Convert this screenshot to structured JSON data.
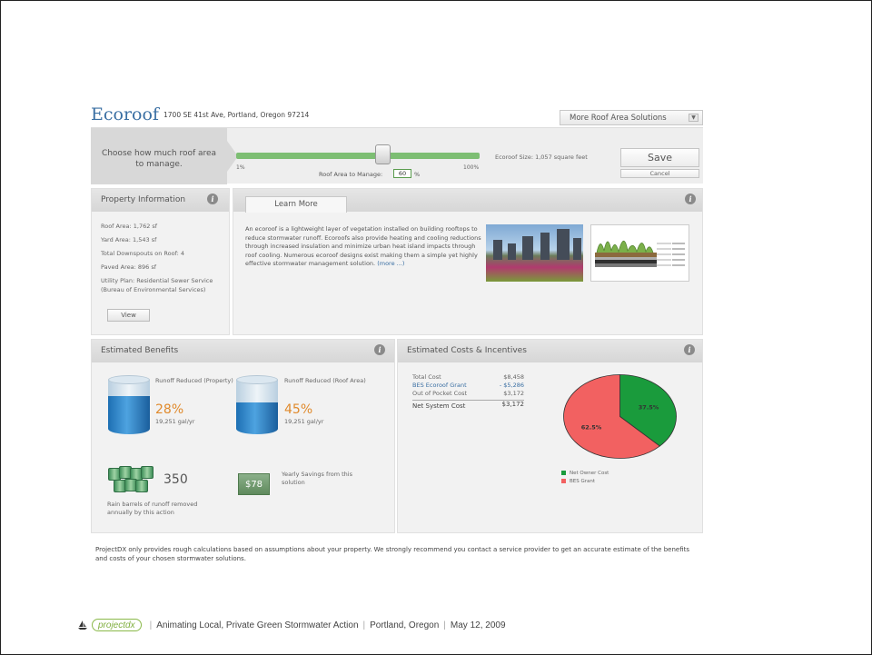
{
  "header": {
    "title": "Ecoroof",
    "address": "1700 SE 41st Ave, Portland, Oregon 97214",
    "more_solutions": "More Roof Area Solutions"
  },
  "control": {
    "choose_text": "Choose how much roof area to manage.",
    "slider_min": "1%",
    "slider_max": "100%",
    "slider_value_fraction": 0.6,
    "manage_label": "Roof Area to Manage:",
    "manage_value": "60",
    "manage_unit": "%",
    "ecoroof_size": "Ecoroof Size: 1,057 square feet",
    "save_label": "Save",
    "cancel_label": "Cancel"
  },
  "property": {
    "title": "Property Information",
    "items": [
      "Roof Area: 1,762 sf",
      "Yard Area: 1,543 sf",
      "Total Downspouts on Roof: 4",
      "Paved Area: 896 sf",
      "Utility Plan: Residential Sewer Service (Bureau of Environmental Services)"
    ],
    "view_label": "View"
  },
  "learn": {
    "tab_label": "Learn More",
    "text": "An ecoroof is a lightweight layer of vegetation installed on building rooftops to reduce stormwater runoff. Ecoroofs also provide heating and cooling reductions through increased insulation and minimize urban heat island impacts through roof cooling. Numerous ecoroof designs exist making them a simple yet highly effective stormwater management solution.",
    "more_link": "(more ...)"
  },
  "benefits": {
    "title": "Estimated Benefits",
    "property": {
      "label": "Runoff Reduced (Property)",
      "percent": "28%",
      "gallons": "19,251 gal/yr",
      "fill_fraction": 0.28
    },
    "roof": {
      "label": "Runoff Reduced (Roof Area)",
      "percent": "45%",
      "gallons": "19,251 gal/yr",
      "fill_fraction": 0.45
    },
    "barrels_count": "350",
    "barrels_text": "Rain barrels of runoff removed annually by this action",
    "savings_amount": "$78",
    "savings_text": "Yearly Savings from this solution"
  },
  "costs": {
    "title": "Estimated Costs & Incentives",
    "rows": [
      {
        "label": "Total Cost",
        "value": "$8,458"
      },
      {
        "label": "BES Ecoroof Grant",
        "value": "- $5,286"
      },
      {
        "label": "Out of Pocket Cost",
        "value": "$3,172"
      }
    ],
    "net_label": "Net System Cost",
    "net_value": "$3,172",
    "legend_net": "Net Owner Cost",
    "legend_bes": "BES Grant",
    "colors": {
      "net": "#1a9b3c",
      "bes": "#f26161"
    }
  },
  "chart_data": {
    "type": "pie",
    "categories": [
      "Net Owner Cost",
      "BES Grant"
    ],
    "values": [
      37.5,
      62.5
    ],
    "labels": [
      "37.5%",
      "62.5%"
    ]
  },
  "disclaimer": "ProjectDX only provides rough calculations based on assumptions about your property. We strongly recommend you contact a service provider to get an accurate estimate of the benefits and costs of your chosen stormwater solutions.",
  "footer": {
    "logo_text": "projectdx",
    "title": "Animating Local, Private Green Stormwater Action",
    "location": "Portland, Oregon",
    "date": "May 12, 2009"
  }
}
